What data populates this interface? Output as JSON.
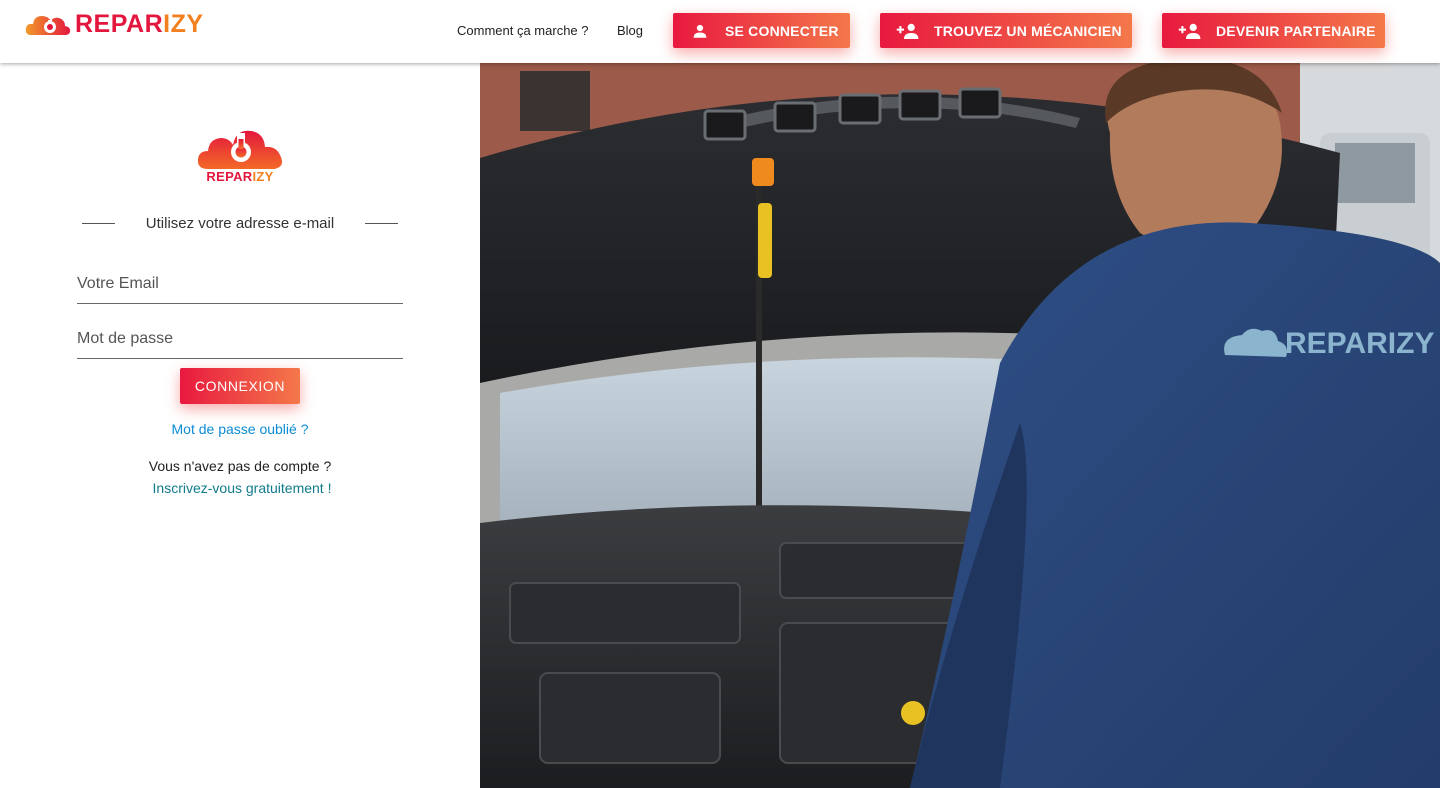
{
  "header": {
    "brand": {
      "part1": "REPAR",
      "part2": "IZY"
    },
    "nav": {
      "how_it_works": "Comment ça marche ?",
      "blog": "Blog"
    },
    "buttons": {
      "login": "SE CONNECTER",
      "find_mechanic": "TROUVEZ UN MÉCANICIEN",
      "become_partner": "DEVENIR PARTENAIRE"
    }
  },
  "login": {
    "logo": {
      "part1": "REPAR",
      "part2": "IZY"
    },
    "divider_text": "Utilisez votre adresse e-mail",
    "email_placeholder": "Votre Email",
    "password_placeholder": "Mot de passe",
    "submit_label": "CONNEXION",
    "forgot_password": "Mot de passe oublié ?",
    "no_account": "Vous n'avez pas de compte ?",
    "signup_link": "Inscrivez-vous gratuitement !"
  },
  "hero": {
    "shirt_logo": "REPARIZY"
  },
  "colors": {
    "brand_red": "#e3173e",
    "brand_orange": "#f3801f",
    "link_blue": "#0d8bd6",
    "link_teal": "#117a8b"
  }
}
